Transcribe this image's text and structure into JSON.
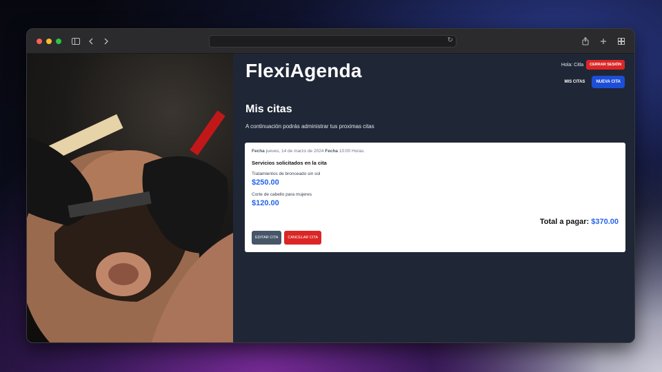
{
  "browser": {
    "icons": [
      "sidebar-icon",
      "back-icon",
      "forward-icon",
      "reload-icon",
      "share-icon",
      "new-tab-icon",
      "tab-overview-icon"
    ]
  },
  "header": {
    "brand": "FlexiAgenda",
    "greeting": "Hola: Citla",
    "logout_label": "CERRAR SESIÓN",
    "my_appointments_label": "MIS CITAS",
    "new_appointment_label": "NUEVA CITA"
  },
  "main": {
    "title": "Mis citas",
    "subtitle": "A continuación podrás administrar tus proximas citas"
  },
  "appointment": {
    "date_label": "Fecha",
    "date_value": "jueves, 14 de marzo de 2024",
    "time_label": "Fecha",
    "time_value": "10:00 Horas.",
    "services_title": "Servicios solicitados en la cita",
    "services": [
      {
        "name": "Tratamientos de bronceado sin sol",
        "price": "$250.00"
      },
      {
        "name": "Corte de cabello para mujeres",
        "price": "$120.00"
      }
    ],
    "total_label": "Total a pagar:",
    "total_value": "$370.00",
    "edit_label": "EDITAR CITA",
    "cancel_label": "CANCELAR CITA"
  },
  "colors": {
    "accent_blue": "#2563eb",
    "danger_red": "#dc2626",
    "main_bg": "#1f2736"
  }
}
